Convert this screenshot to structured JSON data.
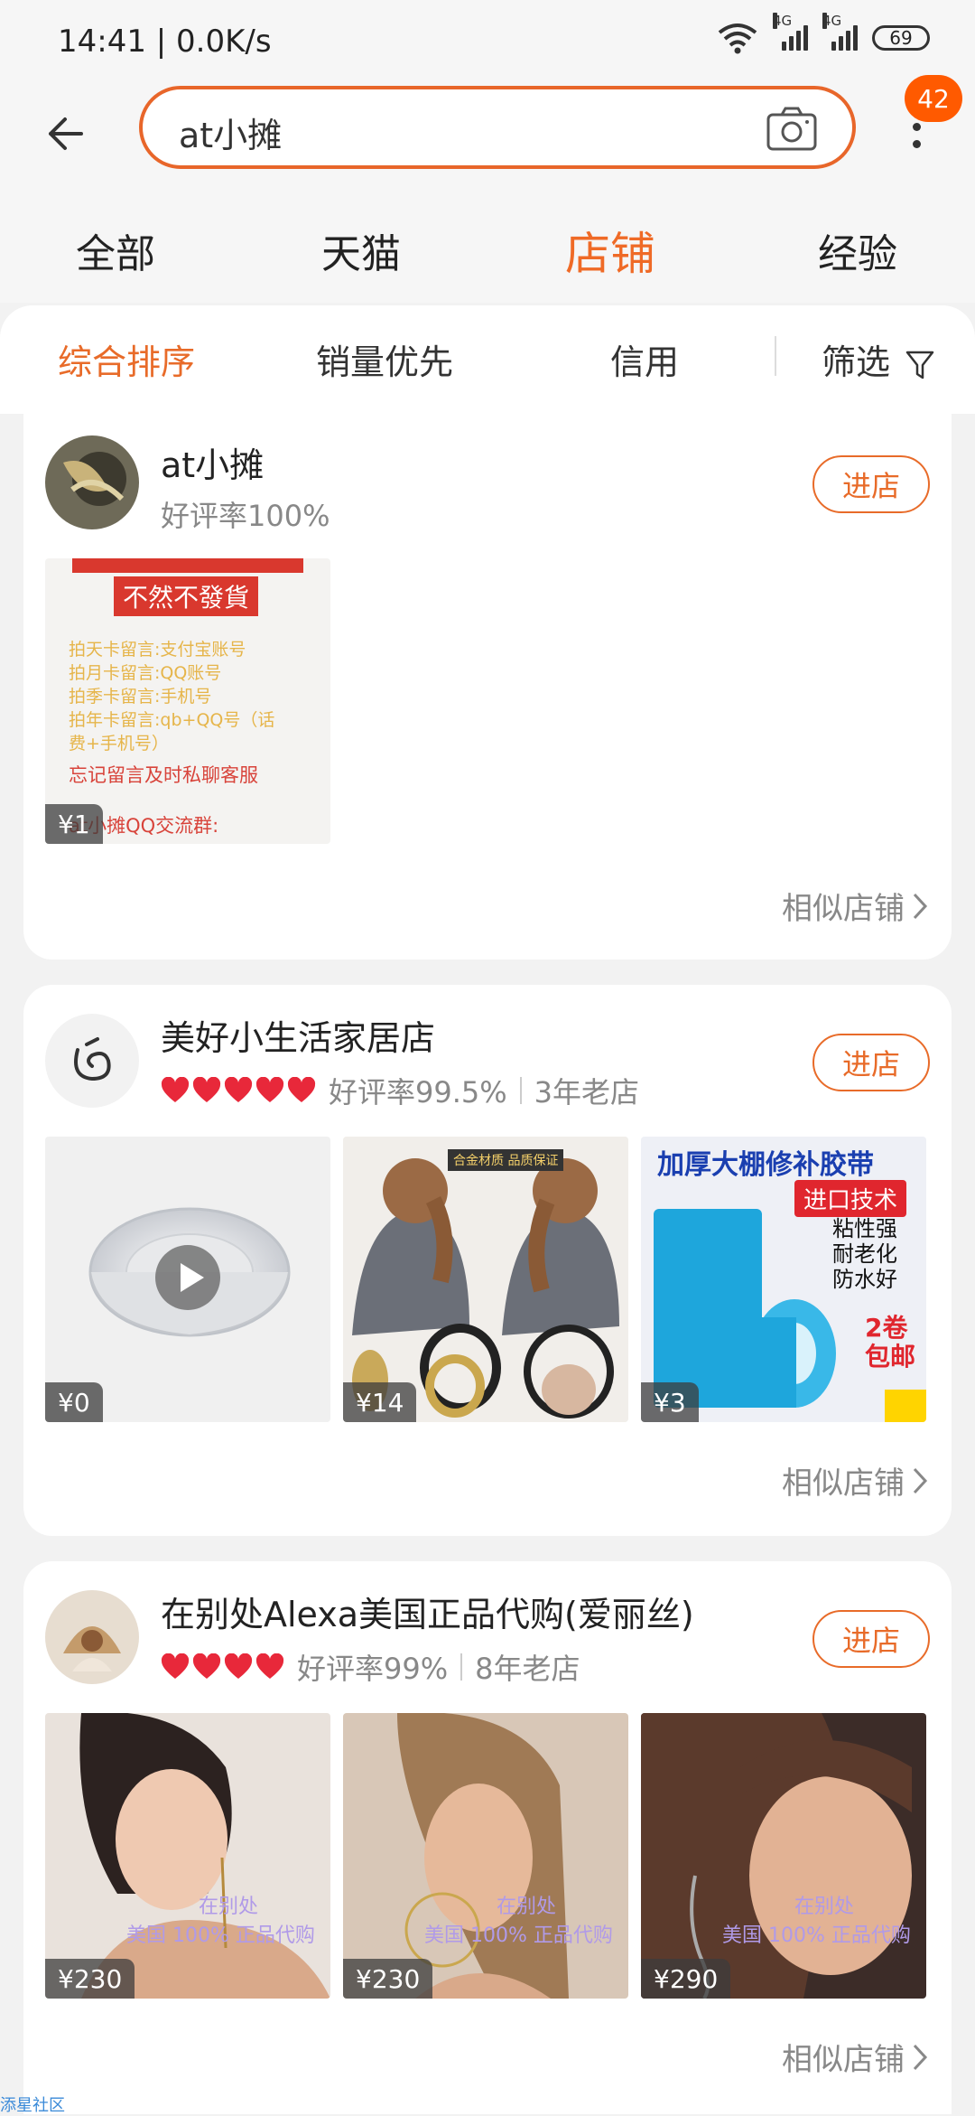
{
  "status_bar": {
    "time": "14:41 | 0.0K/s",
    "battery": "69",
    "net1": "4G",
    "net2": "4G"
  },
  "header": {
    "search_text": "at小摊",
    "notification_count": "42"
  },
  "tabs": [
    {
      "label": "全部"
    },
    {
      "label": "天猫"
    },
    {
      "label": "店铺",
      "active": true
    },
    {
      "label": "经验"
    }
  ],
  "sort": {
    "comprehensive": "综合排序",
    "sales": "销量优先",
    "credit": "信用",
    "filter": "筛选"
  },
  "stores": [
    {
      "name": "at小摊",
      "rating": "好评率100%",
      "enter": "进店",
      "similar": "相似店铺",
      "products": [
        {
          "price": "¥1",
          "notice": {
            "stamp": "不然不發貨",
            "lines": [
              "拍天卡留言:支付宝账号",
              "拍月卡留言:QQ账号",
              "拍季卡留言:手机号",
              "拍年卡留言:qb+QQ号（话",
              "费+手机号）"
            ],
            "red_lines": [
              "忘记留言及时私聊客服",
              "at小摊QQ交流群:"
            ]
          }
        }
      ]
    },
    {
      "name": "美好小生活家居店",
      "hearts": 5,
      "rating": "好评率99.5%",
      "age": "3年老店",
      "enter": "进店",
      "similar": "相似店铺",
      "products": [
        {
          "price": "¥0"
        },
        {
          "price": "¥14",
          "banner": "合金材质 品质保证"
        },
        {
          "price": "¥3",
          "title": "加厚大棚修补胶带",
          "tag": "进口技术",
          "features": [
            "粘性强",
            "耐老化",
            "防水好"
          ],
          "promo": [
            "2卷",
            "包邮"
          ]
        }
      ]
    },
    {
      "name": "在别处Alexa美国正品代购(爱丽丝)",
      "hearts": 4,
      "rating": "好评率99%",
      "age": "8年老店",
      "enter": "进店",
      "similar": "相似店铺",
      "products": [
        {
          "price": "¥230",
          "watermark": [
            "在别处",
            "美国 100% 正品代购"
          ]
        },
        {
          "price": "¥230",
          "watermark": [
            "在别处",
            "美国 100% 正品代购"
          ]
        },
        {
          "price": "¥290",
          "watermark": [
            "在别处",
            "美国 100% 正品代购"
          ]
        }
      ]
    }
  ],
  "footer": {
    "tag": "添星社区"
  },
  "colors": {
    "accent": "#e86b29",
    "badge": "#ff5a00",
    "heart": "#e8283a"
  }
}
